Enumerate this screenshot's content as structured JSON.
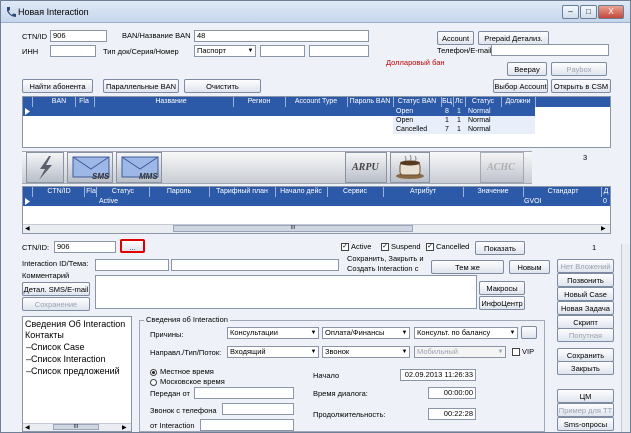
{
  "window": {
    "title": "Новая Interaction",
    "min_label": "–",
    "max_label": "□",
    "close_label": "X"
  },
  "top": {
    "ctn_label": "CTN/ID",
    "ctn_value": "906",
    "ban_label": "BAN/Название BAN",
    "ban_value": "48",
    "inn_label": "ИНН",
    "doc_label": "Тип док/Серия/Номер",
    "doc_type": "Паспорт",
    "phone_label": "Телефон/E-mail",
    "dollar_ban": "Долларовый бан",
    "account_btn": "Account",
    "prepaid_btn": "Prepaid Детализ.",
    "beepay_btn": "Beepay",
    "paybox_btn": "Paybox",
    "find_btn": "Найти абонента",
    "parallel_btn": "Параллельные BAN",
    "clear_btn": "Очистить",
    "select_account_btn": "Выбор Account",
    "open_csm_btn": "Открыть в CSM"
  },
  "ban_grid": {
    "headers": [
      "BAN",
      "Fla",
      "Название",
      "Регион",
      "Account Type",
      "Пароль BAN",
      "Статус BAN",
      "БЦ",
      "Лс",
      "Статус",
      "Должни"
    ],
    "rows": [
      {
        "status": "Open",
        "bc": "8",
        "ls": "1",
        "st": "Normal"
      },
      {
        "status": "Open",
        "bc": "1",
        "ls": "1",
        "st": "Normal"
      },
      {
        "status": "Cancelled",
        "bc": "7",
        "ls": "1",
        "st": "Normal"
      }
    ]
  },
  "tools": {
    "sms_label": "SMS",
    "mms_label": "MMS",
    "arpu_label": "ARPU",
    "achc_label": "ACHC",
    "count": "3"
  },
  "ctn_grid": {
    "headers": [
      "CTN/ID",
      "Fla",
      "Статус",
      "Пароль",
      "Тарифный план",
      "Начало дейс",
      "Сервис",
      "Атрибут",
      "Значение",
      "Стандарт",
      "Д"
    ],
    "row": {
      "status": "Active",
      "standard": "GVOI",
      "last": "0"
    },
    "scroll_marker": "III"
  },
  "filter": {
    "ctn_label": "CTN/ID:",
    "ctn_value": "906",
    "browse_btn": "...",
    "active_label": "Active",
    "suspend_label": "Suspend",
    "cancelled_label": "Cancelled",
    "show_btn": "Показать",
    "count": "1"
  },
  "interaction": {
    "id_label": "Interaction ID/Тема:",
    "comment_label": "Комментарий",
    "save_close_text": "Сохранить, Закрыть и",
    "create_text": "Создать Interaction с",
    "same_btn": "Тем же",
    "new_btn": "Новым",
    "detail_btn": "Детал. SMS/E-mail",
    "save_btn": "Сохранение",
    "macros_btn": "Макросы",
    "info_btn": "ИнфоЦентр"
  },
  "right_buttons": {
    "no_attach": "Нет Вложений",
    "call": "Позвонить",
    "new_case": "Новый Case",
    "new_task": "Новая Задача",
    "script": "Скрипт",
    "related": "Попутная",
    "save": "Сохранить",
    "close": "Закрыть",
    "cm": "ЦМ",
    "example": "Пример для ТТ",
    "sms_poll": "Sms-опросы"
  },
  "left_panel": {
    "title": "Сведения Об Interaction",
    "contacts": "Контакты",
    "items": [
      "Список Case",
      "Список Interaction",
      "Список предложений"
    ],
    "scroll_marker": "III"
  },
  "details": {
    "legend": "Сведения об Interaction",
    "reasons_label": "Причины:",
    "reason1": "Консультации",
    "reason2": "Оплата/Финансы",
    "reason3": "Консульт. по балансу",
    "direction_label": "Направл./Тип/Поток:",
    "dir1": "Входящий",
    "dir2": "Звонок",
    "dir3": "Мобильный",
    "vip_label": "VIP",
    "local_time": "Местное время",
    "moscow_time": "Московское время",
    "transfer_label": "Передан от",
    "call_from_label": "Звонок с телефона",
    "from_interaction_label": "от Interaction",
    "start_label": "Начало",
    "start_value": "02.09.2013 11:26:33",
    "dialog_label": "Время диалога:",
    "dialog_value": "00:00:00",
    "duration_label": "Продолжительность:",
    "duration_value": "00:22:28"
  }
}
